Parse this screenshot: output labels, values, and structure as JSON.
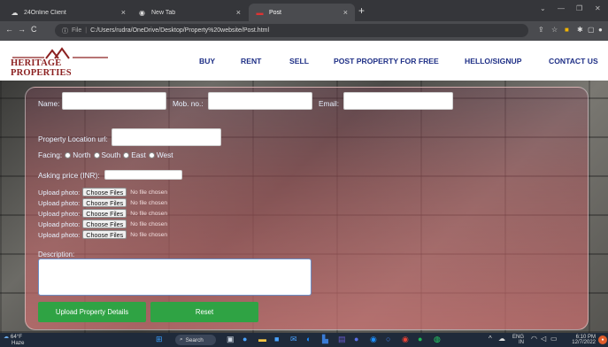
{
  "browser": {
    "tabs": [
      {
        "title": "24Online Client",
        "icon": "cloud-icon",
        "active": false
      },
      {
        "title": "New Tab",
        "icon": "chrome-icon",
        "active": false
      },
      {
        "title": "Post",
        "icon": "page-icon",
        "active": true
      }
    ],
    "new_tab": "+",
    "address": {
      "scheme_label": "File",
      "url": "C:/Users/rudra/OneDrive/Desktop/Property%20website/Post.html"
    }
  },
  "site": {
    "logo_text": "HERITAGE PROPERTIES",
    "nav": [
      "BUY",
      "RENT",
      "SELL",
      "POST PROPERTY FOR FREE",
      "HELLO/SIGNUP",
      "CONTACT US"
    ]
  },
  "form": {
    "name_label": "Name:",
    "mob_label": "Mob. no.:",
    "email_label": "Email:",
    "location_label": "Property Location url:",
    "facing_label": "Facing:",
    "facing_options": [
      "North",
      "South",
      "East",
      "West"
    ],
    "price_label": "Asking price (INR):",
    "upload_label": "Upload photo:",
    "choose_label": "Choose Files",
    "no_file_label": "No file chosen",
    "upload_rows": 5,
    "description_label": "Description:",
    "submit_label": "Upload Property Details",
    "reset_label": "Reset"
  },
  "taskbar": {
    "weather_temp": "64°F",
    "weather_desc": "Haze",
    "search_label": "Search",
    "language": "ENG",
    "region": "IN",
    "time": "6:10 PM",
    "date": "12/7/2022"
  },
  "colors": {
    "nav_text": "#1e2f86",
    "logo_red": "#8c2121",
    "button_green": "#2fa344"
  }
}
